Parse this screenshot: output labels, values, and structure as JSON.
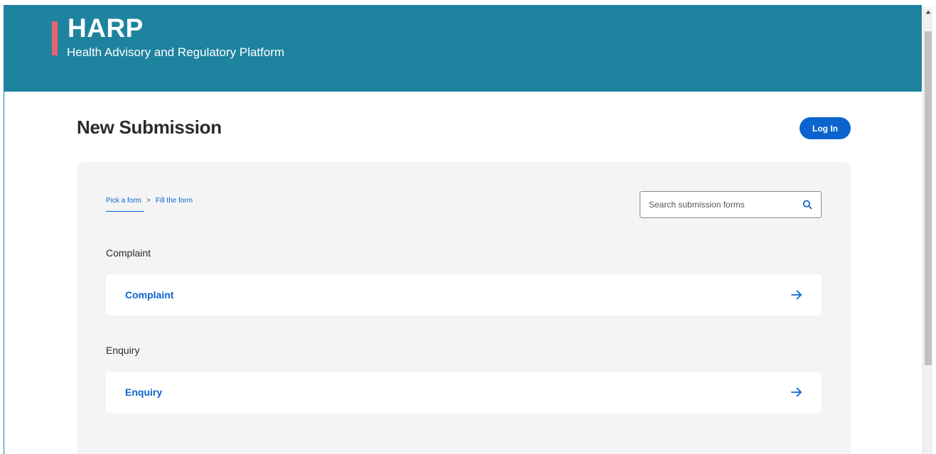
{
  "header": {
    "title": "HARP",
    "subtitle": "Health Advisory and Regulatory Platform"
  },
  "page": {
    "title": "New Submission",
    "login_label": "Log In"
  },
  "breadcrumb": {
    "step1": "Pick a form",
    "separator": ">",
    "step2": "Fill the form"
  },
  "search": {
    "placeholder": "Search submission forms",
    "value": ""
  },
  "sections": [
    {
      "label": "Complaint",
      "item": "Complaint"
    },
    {
      "label": "Enquiry",
      "item": "Enquiry"
    }
  ],
  "icons": {
    "search": "search-icon",
    "arrow": "arrow-right-icon",
    "scroll_up": "chevron-up-icon"
  },
  "colors": {
    "header_bg": "#1e839f",
    "logo_accent": "#e8636e",
    "primary": "#0b63ce",
    "panel_bg": "#f4f4f4"
  }
}
